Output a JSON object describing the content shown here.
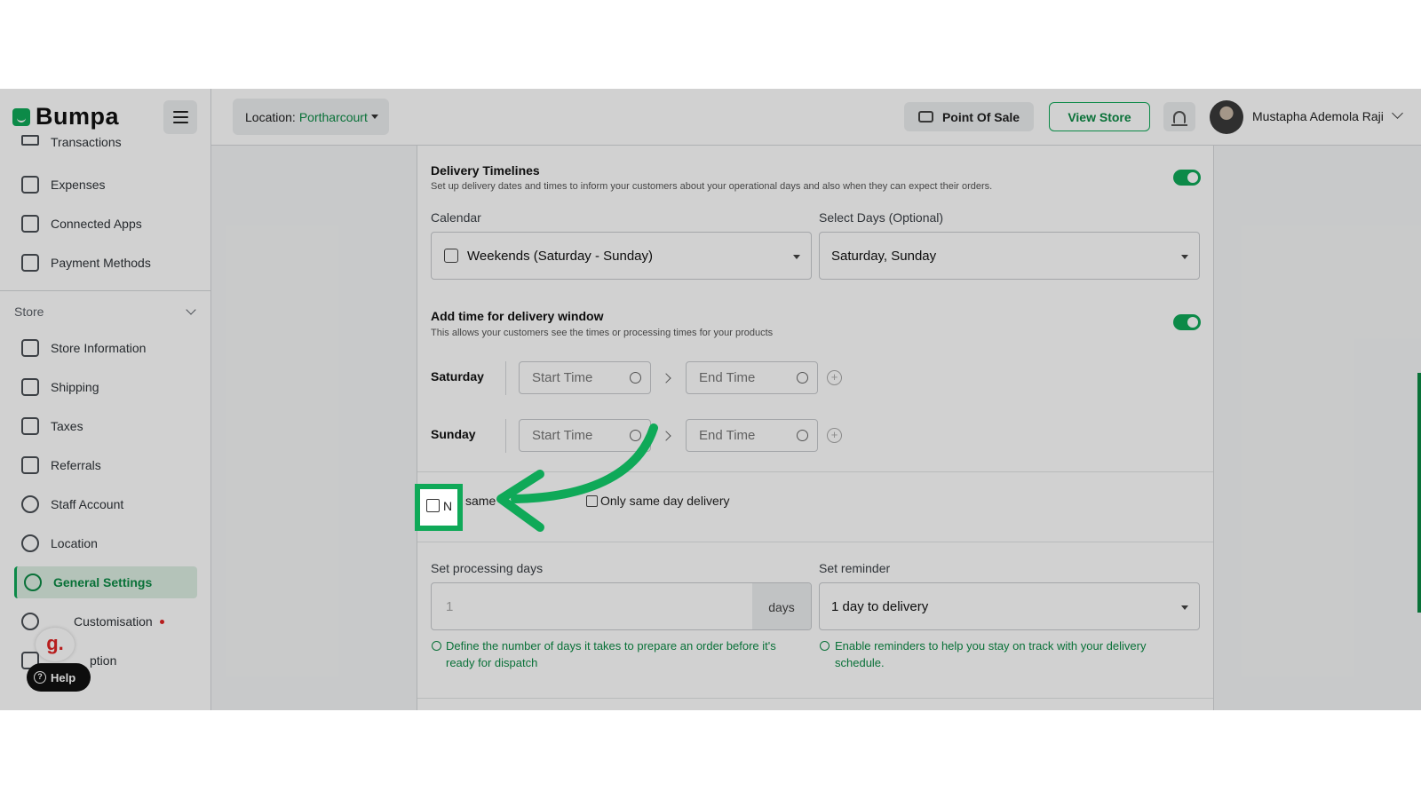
{
  "brand": {
    "name": "Bumpa"
  },
  "sidebar": {
    "items": [
      {
        "label": "Transactions",
        "icon": "transactions-icon"
      },
      {
        "label": "Expenses",
        "icon": "expenses-icon"
      },
      {
        "label": "Connected Apps",
        "icon": "connected-apps-icon"
      },
      {
        "label": "Payment Methods",
        "icon": "payment-methods-icon"
      }
    ],
    "section": "Store",
    "store_items": [
      {
        "label": "Store Information",
        "icon": "store-icon"
      },
      {
        "label": "Shipping",
        "icon": "shipping-icon"
      },
      {
        "label": "Taxes",
        "icon": "taxes-icon"
      },
      {
        "label": "Referrals",
        "icon": "megaphone-icon"
      },
      {
        "label": "Staff Account",
        "icon": "user-icon"
      },
      {
        "label": "Location",
        "icon": "location-pin-icon"
      },
      {
        "label": "General Settings",
        "icon": "gear-icon",
        "active": true
      },
      {
        "label": "Customisation",
        "icon": "palette-icon"
      },
      {
        "label": "ption",
        "icon": "subscription-icon"
      }
    ],
    "help_label": "Help",
    "g_badge": "g."
  },
  "topbar": {
    "location_label": "Location:",
    "location_value": "Portharcourt",
    "pos_label": "Point Of Sale",
    "view_store_label": "View Store",
    "user_name": "Mustapha Ademola Raji"
  },
  "delivery": {
    "title": "Delivery Timelines",
    "description": "Set up delivery dates and times to inform your customers about your operational days and also when they can expect their orders.",
    "calendar_label": "Calendar",
    "calendar_value": "Weekends (Saturday - Sunday)",
    "select_days_label": "Select Days (Optional)",
    "select_days_value": "Saturday, Sunday"
  },
  "window": {
    "title": "Add time for delivery window",
    "description": "This allows your customers see the times or processing times for your products",
    "days": [
      {
        "day": "Saturday",
        "start_placeholder": "Start Time",
        "end_placeholder": "End Time"
      },
      {
        "day": "Sunday",
        "start_placeholder": "Start Time",
        "end_placeholder": "End Time"
      }
    ]
  },
  "options": {
    "no_same_day_visible": "N",
    "no_same_day_partial": "same",
    "only_same_day": "Only same day delivery"
  },
  "processing": {
    "label": "Set processing days",
    "value": "1",
    "suffix": "days",
    "info": "Define the number of days it takes to prepare an order before it's ready for dispatch"
  },
  "reminder": {
    "label": "Set reminder",
    "value": "1 day to delivery",
    "info": "Enable reminders to help you stay on track with your delivery schedule."
  },
  "colors": {
    "brand_green": "#0fa958",
    "highlight": "#0fa958",
    "text_green": "#0c8a45"
  }
}
